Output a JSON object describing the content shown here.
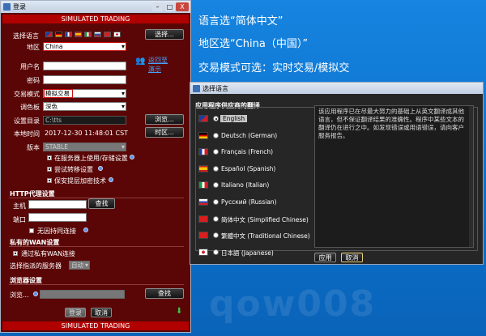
{
  "annotations": {
    "line1": "语言选“简体中文”",
    "line2": "地区选“China（中国）”",
    "line3": "交易模式可选：实时交易/模拟交",
    "watermark": "qow008"
  },
  "login": {
    "title": "登录",
    "banner_top": "SIMULATED TRADING",
    "banner_bottom": "SIMULATED TRADING",
    "win_minimize": "–",
    "win_maximize": "□",
    "win_close": "X",
    "language_label": "选择语言",
    "choose_button": "选择...",
    "region_label": "地区",
    "region_value": "China",
    "username_label": "用户名",
    "username_value": "",
    "password_label": "密码",
    "password_value": "",
    "trade_mode_label": "交易模式",
    "trade_mode_value": "模拟交易",
    "palette_label": "调色板",
    "palette_value": "深色",
    "settings_dir_label": "设置目录",
    "settings_dir_value": "C:\\tts",
    "browse_button": "浏览...",
    "local_time_label": "本地时间",
    "local_time_value": "2017-12-30 11:48:01 CST",
    "timezone_button": "时区...",
    "version_label": "版本",
    "version_value": "STABLE",
    "back_link_1": "返回至",
    "back_link_2": "演示",
    "chk_server_storage": "在服务器上使用/存储设置",
    "chk_autoload": "尝试转移设置",
    "chk_encrypt": "保安提层加密技术",
    "http_proxy_section": "HTTP代理设置",
    "host_label": "主机",
    "host_value": "",
    "find_button": "查找",
    "port_label": "端口",
    "port_value": "",
    "chk_no_timeout": "无因持同连接",
    "wan_section": "私有的WAN设置",
    "chk_wan": "通过私有WAN连接",
    "server_label": "选择指派的服务器",
    "server_value": "自动",
    "browser_section": "浏览器设置",
    "browse_label": "浏览...",
    "browser_value": "",
    "browser_find_button": "查找",
    "login_button": "登录",
    "cancel_button": "取消"
  },
  "lang_dialog": {
    "title": "选择语言",
    "group_title": "应用程序供应商的翻译",
    "languages": [
      {
        "label": "English",
        "selected": true
      },
      {
        "label": "Deutsch (German)",
        "selected": false
      },
      {
        "label": "Français (French)",
        "selected": false
      },
      {
        "label": "Español (Spanish)",
        "selected": false
      },
      {
        "label": "Italiano (Italian)",
        "selected": false
      },
      {
        "label": "Русский (Russian)",
        "selected": false
      },
      {
        "label": "简体中文 (Simplified Chinese)",
        "selected": false
      },
      {
        "label": "繁體中文 (Traditional Chinese)",
        "selected": false
      },
      {
        "label": "日本語 (Japanese)",
        "selected": false
      }
    ],
    "description": "该应用程序已在尽最大努力的基础上从英文翻译成其他语言，但不保证翻译结果的准确性。程序中某些文本的翻译仍在进行之中。如发现错误或用语错误，请向客户服务报告。",
    "ok_button": "应用",
    "cancel_button": "取消",
    "close": "X"
  },
  "colors": {
    "login_bg": "#5a0606",
    "banner": "#b00000",
    "desktop": "#0b7ad6"
  }
}
